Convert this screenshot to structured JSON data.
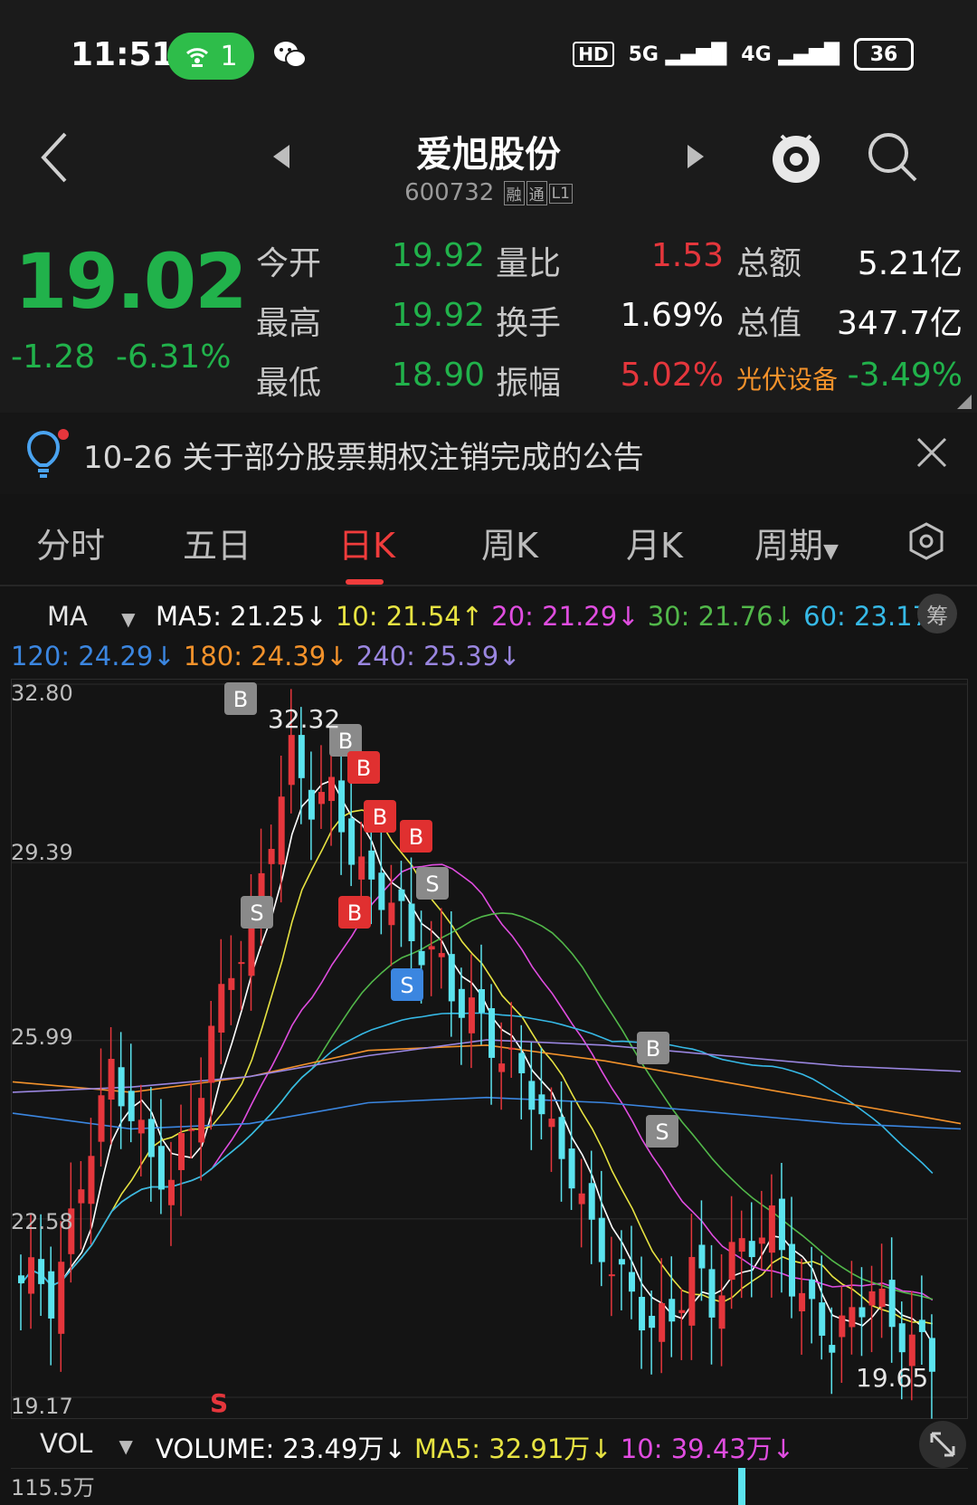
{
  "status_bar": {
    "time": "11:51",
    "hotspot_count": "1",
    "hd_badge": "HD",
    "net1": "5G",
    "net2": "4G",
    "battery": "36"
  },
  "header": {
    "name": "爱旭股份",
    "code": "600732",
    "tags": [
      "融",
      "通",
      "L1"
    ]
  },
  "quote": {
    "price": "19.02",
    "change": "-1.28",
    "change_pct": "-6.31%",
    "rows": [
      {
        "l1": "今开",
        "v1": "19.92",
        "l2": "量比",
        "v2": "1.53",
        "l3": "总额",
        "v3": "5.21亿"
      },
      {
        "l1": "最高",
        "v1": "19.92",
        "l2": "换手",
        "v2": "1.69%",
        "l3": "总值",
        "v3": "347.7亿"
      },
      {
        "l1": "最低",
        "v1": "18.90",
        "l2": "振幅",
        "v2": "5.02%",
        "l3": "光伏设备",
        "v3": "-3.49%"
      }
    ],
    "colors": {
      "up": "#e5363c",
      "down": "#21b24b"
    }
  },
  "notice": {
    "text": "10-26 关于部分股票期权注销完成的公告"
  },
  "tabs": [
    {
      "label": "分时"
    },
    {
      "label": "五日"
    },
    {
      "label": "日K"
    },
    {
      "label": "周K"
    },
    {
      "label": "月K"
    },
    {
      "label": "周期"
    }
  ],
  "ma_legend": {
    "title": "MA",
    "line1": [
      {
        "text": "MA5: 21.25↓",
        "color": "#ffffff"
      },
      {
        "text": "10: 21.54↑",
        "color": "#e7e342"
      },
      {
        "text": "20: 21.29↓",
        "color": "#e04de0"
      },
      {
        "text": "30: 21.76↓",
        "color": "#52b84a"
      },
      {
        "text": "60: 23.17↓",
        "color": "#36b9e6"
      }
    ],
    "line2": [
      {
        "text": "120: 24.29↓",
        "color": "#3b86e0"
      },
      {
        "text": "180: 24.39↓",
        "color": "#f3922b"
      },
      {
        "text": "240: 25.39↓",
        "color": "#9a86e0"
      }
    ],
    "chip": "筹"
  },
  "chart": {
    "y_ticks": [
      "32.80",
      "29.39",
      "25.99",
      "22.58",
      "19.17"
    ],
    "high_label": "32.32",
    "low_label": "19.65",
    "s_marker": "S"
  },
  "chart_data": {
    "type": "candlestick",
    "ylim": [
      19.17,
      32.8
    ],
    "y_ticks": [
      32.8,
      29.39,
      25.99,
      22.58,
      19.17
    ],
    "annotations": [
      {
        "text": "32.32",
        "kind": "high"
      },
      {
        "text": "19.65",
        "kind": "low"
      }
    ],
    "signals": [
      "B",
      "B",
      "B",
      "B",
      "B",
      "B",
      "S",
      "S",
      "S",
      "B",
      "S"
    ],
    "closes_approx": [
      21.5,
      21.0,
      22.5,
      24.0,
      25.5,
      24.5,
      23.8,
      23.2,
      24.5,
      26.0,
      27.5,
      28.0,
      30.0,
      31.5,
      30.5,
      30.8,
      29.5,
      29.0,
      28.6,
      28.0,
      27.6,
      27.0,
      26.5,
      26.0,
      25.5,
      25.0,
      24.2,
      23.4,
      22.4,
      21.6,
      21.2,
      20.4,
      20.8,
      21.6,
      21.0,
      21.8,
      22.2,
      22.5,
      21.4,
      20.8,
      20.2,
      20.8,
      21.2,
      20.6,
      20.2,
      19.9
    ]
  },
  "volume": {
    "title": "VOL",
    "items": [
      {
        "text": "VOLUME: 23.49万↓",
        "color": "#ffffff"
      },
      {
        "text": "MA5: 32.91万↓",
        "color": "#e7e342"
      },
      {
        "text": "10: 39.43万↓",
        "color": "#e04de0"
      }
    ],
    "top_label": "115.5万"
  }
}
